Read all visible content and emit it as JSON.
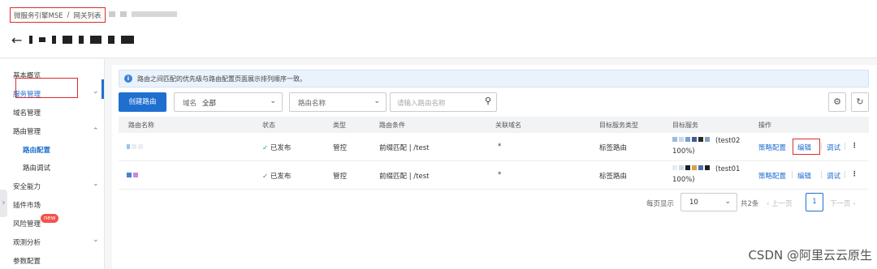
{
  "breadcrumb": {
    "root": "微服务引擎MSE",
    "separator": "/",
    "current": "网关列表"
  },
  "header": {
    "back_icon": "arrow-left-icon"
  },
  "sidebar": {
    "items": [
      {
        "label": "基本概览"
      },
      {
        "label": "服务管理",
        "expanded": false
      },
      {
        "label": "域名管理"
      },
      {
        "label": "路由管理",
        "expanded": true
      },
      {
        "label": "路由配置",
        "active": true
      },
      {
        "label": "路由调试"
      },
      {
        "label": "安全能力",
        "expanded": false
      },
      {
        "label": "插件市场"
      },
      {
        "label": "风险管理",
        "badge": "new"
      },
      {
        "label": "观测分析",
        "expanded": false
      },
      {
        "label": "参数配置"
      }
    ],
    "collapse_icon": "chevron-right-icon"
  },
  "notice": {
    "icon": "info-icon",
    "text": "路由之间匹配的优先级与路由配置页面展示排列顺序一致。"
  },
  "toolbar": {
    "create_label": "创建路由",
    "domain_label": "域名",
    "domain_value": "全部",
    "field_value": "路由名称",
    "search_placeholder": "请输入路由名称",
    "search_icon": "search-icon",
    "settings_icon": "gear-icon",
    "refresh_icon": "refresh-icon"
  },
  "table": {
    "columns": [
      "路由名称",
      "状态",
      "类型",
      "路由条件",
      "关联域名",
      "目标服务类型",
      "目标服务",
      "操作"
    ],
    "rows": [
      {
        "status": "已发布",
        "type": "管控",
        "condition": "前缀匹配 | /test",
        "domain": "*",
        "target_type": "标签路由",
        "target_suffix": "(test02",
        "target_percent": "100%)",
        "actions": [
          "策略配置",
          "编辑",
          "调试"
        ]
      },
      {
        "status": "已发布",
        "type": "管控",
        "condition": "前缀匹配 | /test",
        "domain": "*",
        "target_type": "标签路由",
        "target_suffix": "(test01",
        "target_percent": "100%)",
        "actions": [
          "策略配置",
          "编辑",
          "调试"
        ]
      }
    ]
  },
  "pager": {
    "per_page_label": "每页显示",
    "per_page_value": "10",
    "total": "共2条",
    "prev": "上一页",
    "current": "1",
    "next": "下一页"
  },
  "watermark": "CSDN @阿里云云原生"
}
